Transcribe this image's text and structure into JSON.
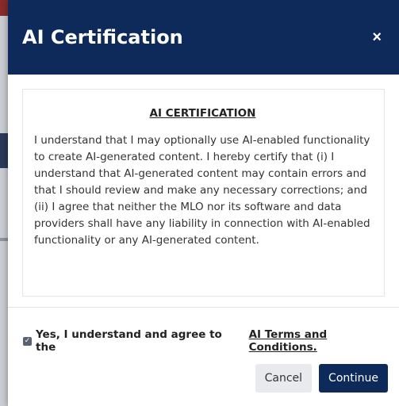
{
  "dialog": {
    "title": "AI Certification",
    "close_symbol": "×",
    "heading": "AI CERTIFICATION",
    "body_text": "I understand that I may optionally use AI-enabled functionality to create AI-generated content. I hereby certify that (i) I understand that AI-generated content may contain errors and that I should review and make any necessary corrections; and (ii) I agree that neither the MLO nor its software and data providers shall have any liability in connection with AI-enabled functionality or any AI-generated content.",
    "agree_text": "Yes, I understand and agree to the",
    "agree_link": "AI Terms and Conditions.",
    "agree_checked": true,
    "cancel_label": "Cancel",
    "continue_label": "Continue"
  },
  "icons": {
    "close": "close-icon",
    "checkbox": "checkbox-checked-icon"
  },
  "colors": {
    "header_bg": "#0e2a5a",
    "primary_button": "#0e2a5a",
    "secondary_button": "#e9eaed"
  }
}
